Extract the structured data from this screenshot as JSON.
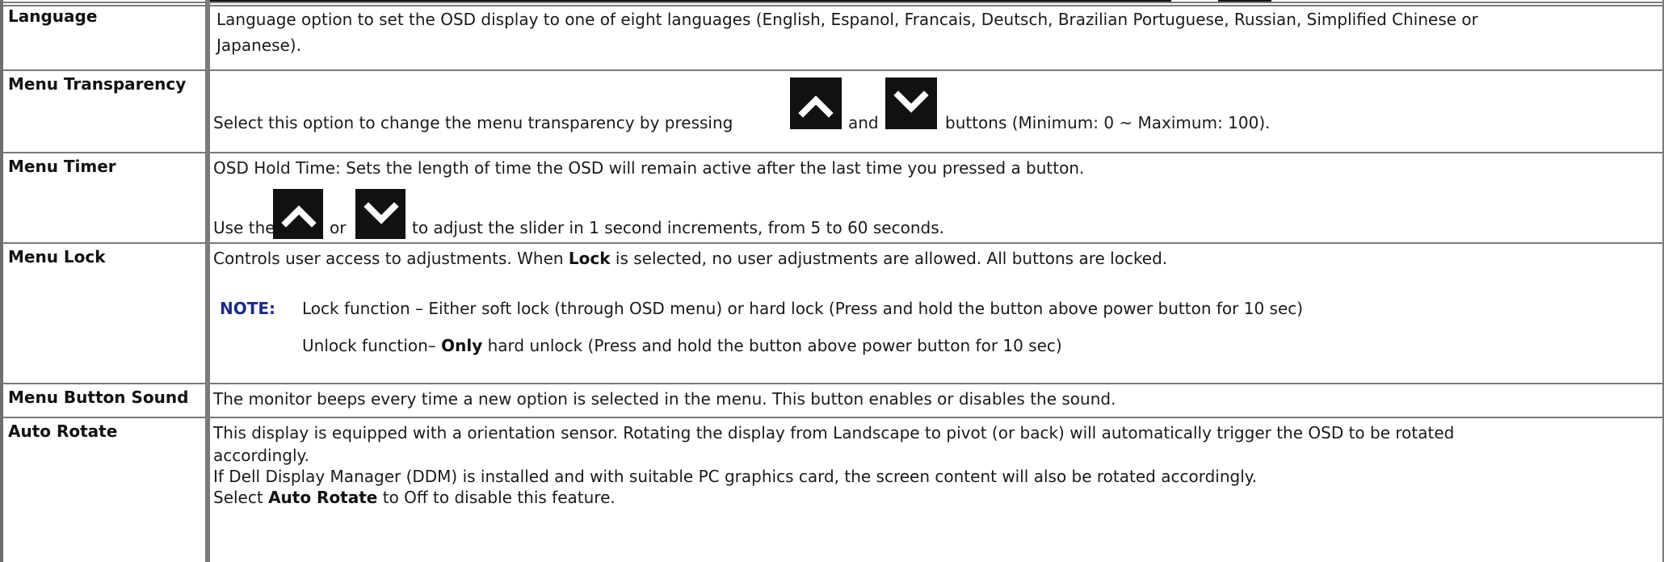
{
  "rows": {
    "language": {
      "label": "Language",
      "line1": "Language option to set the OSD display to one of eight languages (English, Espanol, Francais, Deutsch, Brazilian Portuguese, Russian, Simplified Chinese or",
      "line2": "Japanese)."
    },
    "transparency": {
      "label": "Menu Transparency",
      "text_before": "Select this option to change the menu transparency by pressing",
      "text_middle": "and",
      "text_after": "buttons (Minimum: 0 ~ Maximum: 100)."
    },
    "timer": {
      "label": "Menu Timer",
      "line1": "OSD Hold Time: Sets the length of time the OSD will remain active after the last time you pressed a button.",
      "use_the": "Use the",
      "or": "or",
      "adjust": "to adjust the slider in 1 second increments, from 5 to 60 seconds."
    },
    "lock": {
      "label": "Menu Lock",
      "desc_a": "Controls user access to adjustments. When",
      "desc_bold": "Lock",
      "desc_b": "is selected, no user adjustments are allowed. All buttons are locked.",
      "note_label": "NOTE:",
      "note_line1": "Lock function – Either soft lock (through OSD menu) or hard lock (Press and hold the button above power button for 10 sec)",
      "note_line2_a": "Unlock function–",
      "note_line2_bold": "Only",
      "note_line2_b": "hard unlock (Press and hold the button above power button for 10 sec)"
    },
    "sound": {
      "label": "Menu Button Sound",
      "text": "The monitor beeps every time a new option is selected in the menu. This button enables or disables the sound."
    },
    "rotate": {
      "label": "Auto Rotate",
      "line1": "This display is equipped with a orientation sensor. Rotating the display from Landscape to pivot (or back) will automatically trigger the OSD to be rotated",
      "line2": "accordingly.",
      "line3": "If Dell Display Manager (DDM) is installed and with suitable PC graphics card, the screen content will also be rotated accordingly.",
      "line4_a": "Select",
      "line4_bold": "Auto Rotate",
      "line4_b": "to Off to disable this feature."
    }
  },
  "icons": {
    "up": "chevron-up-icon",
    "down": "chevron-down-icon"
  },
  "colors": {
    "border": "#7a7a7a",
    "note": "#1c2a8a",
    "button": "#111111"
  }
}
